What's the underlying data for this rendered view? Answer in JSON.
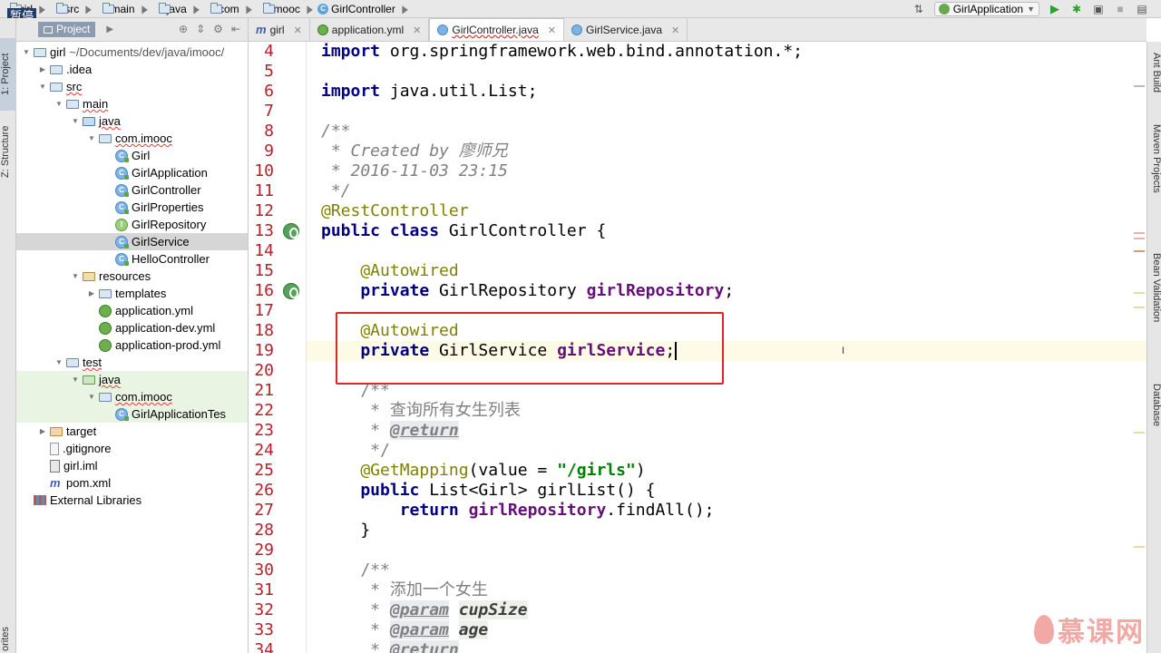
{
  "navbar": {
    "crumbs": [
      "girl",
      "src",
      "main",
      "java",
      "com",
      "imooc",
      "GirlController"
    ],
    "pause_badge": "暂停",
    "run_config": "GirlApplication"
  },
  "left_strip": {
    "project_tab": "1: Project",
    "structure_tab": "Z: Structure",
    "favorites_tab": "orites"
  },
  "project_panel": {
    "title": "Project",
    "tree": [
      {
        "label": "girl",
        "extra": "~/Documents/dev/java/imooc/",
        "indent": 0,
        "arrow": "down",
        "icon": "folder"
      },
      {
        "label": ".idea",
        "indent": 1,
        "arrow": "right",
        "icon": "folder"
      },
      {
        "label": "src",
        "indent": 1,
        "arrow": "down",
        "icon": "folder"
      },
      {
        "label": "main",
        "indent": 2,
        "arrow": "down",
        "icon": "folder"
      },
      {
        "label": "java",
        "indent": 3,
        "arrow": "down",
        "icon": "folder-src"
      },
      {
        "label": "com.imooc",
        "indent": 4,
        "arrow": "down",
        "icon": "folder"
      },
      {
        "label": "Girl",
        "indent": 5,
        "arrow": "",
        "icon": "class"
      },
      {
        "label": "GirlApplication",
        "indent": 5,
        "arrow": "",
        "icon": "class"
      },
      {
        "label": "GirlController",
        "indent": 5,
        "arrow": "",
        "icon": "class"
      },
      {
        "label": "GirlProperties",
        "indent": 5,
        "arrow": "",
        "icon": "class"
      },
      {
        "label": "GirlRepository",
        "indent": 5,
        "arrow": "",
        "icon": "interface"
      },
      {
        "label": "GirlService",
        "indent": 5,
        "arrow": "",
        "icon": "class",
        "selected": true
      },
      {
        "label": "HelloController",
        "indent": 5,
        "arrow": "",
        "icon": "class"
      },
      {
        "label": "resources",
        "indent": 3,
        "arrow": "down",
        "icon": "folder-res"
      },
      {
        "label": "templates",
        "indent": 4,
        "arrow": "right",
        "icon": "folder"
      },
      {
        "label": "application.yml",
        "indent": 4,
        "arrow": "",
        "icon": "yml"
      },
      {
        "label": "application-dev.yml",
        "indent": 4,
        "arrow": "",
        "icon": "yml"
      },
      {
        "label": "application-prod.yml",
        "indent": 4,
        "arrow": "",
        "icon": "yml"
      },
      {
        "label": "test",
        "indent": 2,
        "arrow": "down",
        "icon": "folder"
      },
      {
        "label": "java",
        "indent": 3,
        "arrow": "down",
        "icon": "folder-test",
        "test": true
      },
      {
        "label": "com.imooc",
        "indent": 4,
        "arrow": "down",
        "icon": "folder",
        "test": true
      },
      {
        "label": "GirlApplicationTes",
        "indent": 5,
        "arrow": "",
        "icon": "class",
        "test": true
      },
      {
        "label": "target",
        "indent": 1,
        "arrow": "right",
        "icon": "folder-orange"
      },
      {
        "label": ".gitignore",
        "indent": 1,
        "arrow": "",
        "icon": "file"
      },
      {
        "label": "girl.iml",
        "indent": 1,
        "arrow": "",
        "icon": "iml"
      },
      {
        "label": "pom.xml",
        "indent": 1,
        "arrow": "",
        "icon": "maven"
      },
      {
        "label": "External Libraries",
        "indent": 0,
        "arrow": "",
        "icon": "lib"
      }
    ]
  },
  "tabs": [
    {
      "label": "girl",
      "icon": "m",
      "active": false
    },
    {
      "label": "application.yml",
      "icon": "y",
      "active": false
    },
    {
      "label": "GirlController.java",
      "icon": "c",
      "active": true
    },
    {
      "label": "GirlService.java",
      "icon": "c",
      "active": false
    }
  ],
  "editor": {
    "lines": [
      {
        "n": "4"
      },
      {
        "n": "5"
      },
      {
        "n": "6"
      },
      {
        "n": "7"
      },
      {
        "n": "8"
      },
      {
        "n": "9"
      },
      {
        "n": "10"
      },
      {
        "n": "11"
      },
      {
        "n": "12"
      },
      {
        "n": "13"
      },
      {
        "n": "14"
      },
      {
        "n": "15"
      },
      {
        "n": "16"
      },
      {
        "n": "17"
      },
      {
        "n": "18"
      },
      {
        "n": "19"
      },
      {
        "n": "20"
      },
      {
        "n": "21"
      },
      {
        "n": "22"
      },
      {
        "n": "23"
      },
      {
        "n": "24"
      },
      {
        "n": "25"
      },
      {
        "n": "26"
      },
      {
        "n": "27"
      },
      {
        "n": "28"
      },
      {
        "n": "29"
      },
      {
        "n": "30"
      },
      {
        "n": "31"
      },
      {
        "n": "32"
      },
      {
        "n": "33"
      },
      {
        "n": "34"
      }
    ],
    "code": {
      "l4a": "import ",
      "l4b": "org.springframework.web.bind.annotation.*;",
      "l6a": "import ",
      "l6b": "java.util.List;",
      "l8": "/**",
      "l9": " * Created by 廖师兄",
      "l10": " * 2016-11-03 23:15",
      "l11": " */",
      "l12": "@RestController",
      "l13a": "public class ",
      "l13b": "GirlController {",
      "l15": "    @Autowired",
      "l16a": "    private ",
      "l16b": "GirlRepository ",
      "l16c": "girlRepository",
      "l16d": ";",
      "l18": "    @Autowired",
      "l19a": "    private ",
      "l19b": "GirlService ",
      "l19c": "girlService",
      "l19d": ";",
      "l21": "    /**",
      "l22": "     * 查询所有女生列表",
      "l23a": "     * ",
      "l23b": "@return",
      "l24": "     */",
      "l25a": "    @GetMapping",
      "l25b": "(value = ",
      "l25c": "\"/girls\"",
      "l25d": ")",
      "l26a": "    public ",
      "l26b": "List<Girl> girlList() {",
      "l27a": "        return ",
      "l27b": "girlRepository",
      "l27c": ".findAll();",
      "l28": "    }",
      "l30": "    /**",
      "l31": "     * 添加一个女生",
      "l32a": "     * ",
      "l32b": "@param",
      "l32c": " ",
      "l32d": "cupSize",
      "l33a": "     * ",
      "l33b": "@param",
      "l33c": " ",
      "l33d": "age",
      "l34a": "     * ",
      "l34b": "@return"
    }
  },
  "right_strip": {
    "ant": "Ant Build",
    "maven": "Maven Projects",
    "bean": "Bean Validation",
    "db": "Database"
  },
  "watermark": "慕课网",
  "colors": {
    "highlight_box": "#e02626",
    "line_numbers": "#b5212a",
    "keyword": "#000080",
    "annotation": "#808000"
  }
}
